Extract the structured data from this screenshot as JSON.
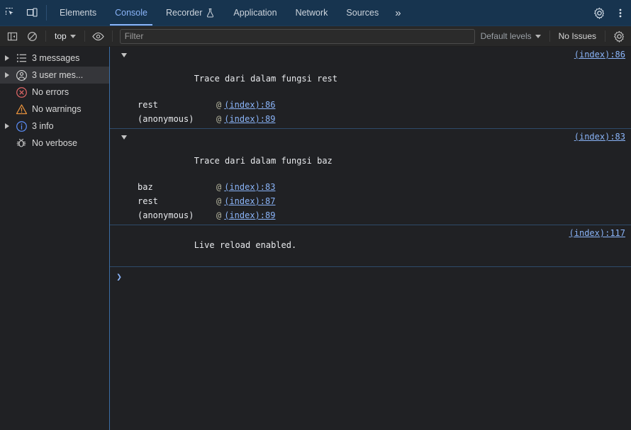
{
  "tabbar": {
    "inspect_icon": "inspect-element-icon",
    "device_icon": "device-toolbar-icon",
    "tabs": [
      {
        "label": "Elements",
        "selected": false,
        "badge": ""
      },
      {
        "label": "Console",
        "selected": true,
        "badge": ""
      },
      {
        "label": "Recorder",
        "selected": false,
        "badge": "flask-icon"
      },
      {
        "label": "Application",
        "selected": false,
        "badge": ""
      },
      {
        "label": "Network",
        "selected": false,
        "badge": ""
      },
      {
        "label": "Sources",
        "selected": false,
        "badge": ""
      }
    ],
    "more_tabs_label": "»",
    "settings_icon": "gear-icon",
    "menu_icon": "kebab-menu-icon",
    "accent_color": "#8ab4f8",
    "background_color": "#17344f"
  },
  "toolbar": {
    "sidebar_toggle_icon": "show-console-sidebar-icon",
    "clear_icon": "clear-console-icon",
    "context_value": "top",
    "eye_icon": "live-expression-icon",
    "filter_placeholder": "Filter",
    "filter_value": "",
    "levels_label": "Default levels",
    "issues_label": "No Issues",
    "settings_icon": "console-settings-gear-icon"
  },
  "sidebar": {
    "items": [
      {
        "label": "3 messages",
        "icon": "list-icon",
        "expandable": true,
        "selected": false
      },
      {
        "label": "3 user mes...",
        "icon": "user-circle-icon",
        "expandable": true,
        "selected": true
      },
      {
        "label": "No errors",
        "icon": "error-circle-icon",
        "expandable": false,
        "selected": false
      },
      {
        "label": "No warnings",
        "icon": "warning-triangle-icon",
        "expandable": false,
        "selected": false
      },
      {
        "label": "3 info",
        "icon": "info-circle-icon",
        "expandable": true,
        "selected": false
      },
      {
        "label": "No verbose",
        "icon": "bug-icon",
        "expandable": false,
        "selected": false
      }
    ]
  },
  "console": {
    "messages": [
      {
        "type": "trace",
        "expanded": true,
        "text": "Trace dari dalam fungsi rest",
        "source": "(index):86",
        "stack": [
          {
            "fn": "rest",
            "at": "@",
            "link": "(index):86"
          },
          {
            "fn": "(anonymous)",
            "at": "@",
            "link": "(index):89"
          }
        ]
      },
      {
        "type": "trace",
        "expanded": true,
        "text": "Trace dari dalam fungsi baz",
        "source": "(index):83",
        "stack": [
          {
            "fn": "baz",
            "at": "@",
            "link": "(index):83"
          },
          {
            "fn": "rest",
            "at": "@",
            "link": "(index):87"
          },
          {
            "fn": "(anonymous)",
            "at": "@",
            "link": "(index):89"
          }
        ]
      },
      {
        "type": "log",
        "expanded": false,
        "text": "Live reload enabled.",
        "source": "(index):117",
        "stack": []
      }
    ],
    "prompt_symbol": "❯",
    "prompt_value": ""
  }
}
